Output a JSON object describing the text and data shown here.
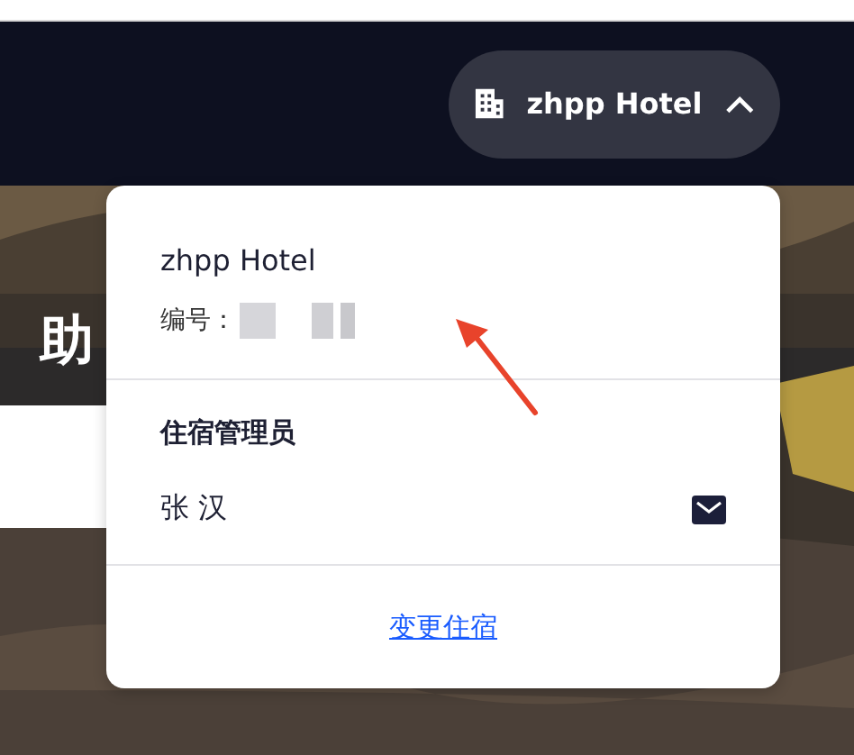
{
  "header": {
    "hotel_button": {
      "label": "zhpp Hotel",
      "expanded": true
    }
  },
  "hero": {
    "heading": "助"
  },
  "dropdown": {
    "hotel_name": "zhpp Hotel",
    "id_label": "编号：",
    "manager_heading": "住宿管理员",
    "manager_name": "张 汉",
    "change_link": "变更住宿"
  }
}
